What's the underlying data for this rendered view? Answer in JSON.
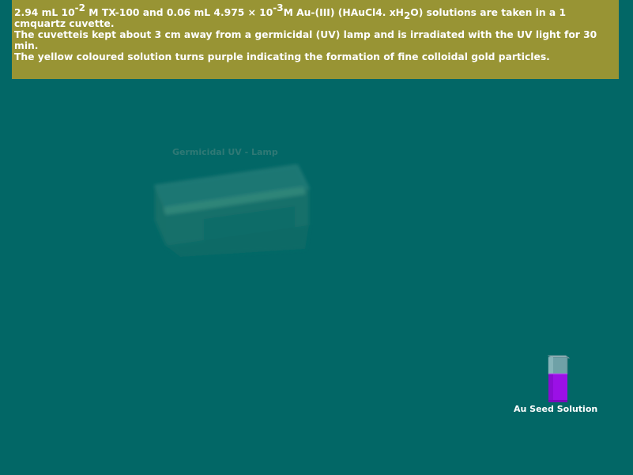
{
  "instructions": {
    "l1_a": "2.94 mL 10",
    "l1_exp1": "-2",
    "l1_b": " M TX-100 and 0.06 mL 4.975 × 10",
    "l1_exp2": "-3",
    "l1_c": "M Au-(III) (HAuCl4. xH",
    "l1_sub": "2",
    "l1_d": "O) solutions are taken in a 1",
    "l2": "cmquartz cuvette.",
    "l3": "The cuvetteis kept about 3 cm away from a germicidal (UV) lamp and is irradiated with the UV light for 30 min.",
    "l4": "The yellow coloured solution turns purple indicating the formation of fine colloidal gold particles."
  },
  "lamp": {
    "label": "Germicidal UV - Lamp"
  },
  "cuvette": {
    "label": "Au Seed Solution",
    "solution_color": "#9b10e6"
  },
  "colors": {
    "background": "#006666",
    "panel": "#989434"
  }
}
